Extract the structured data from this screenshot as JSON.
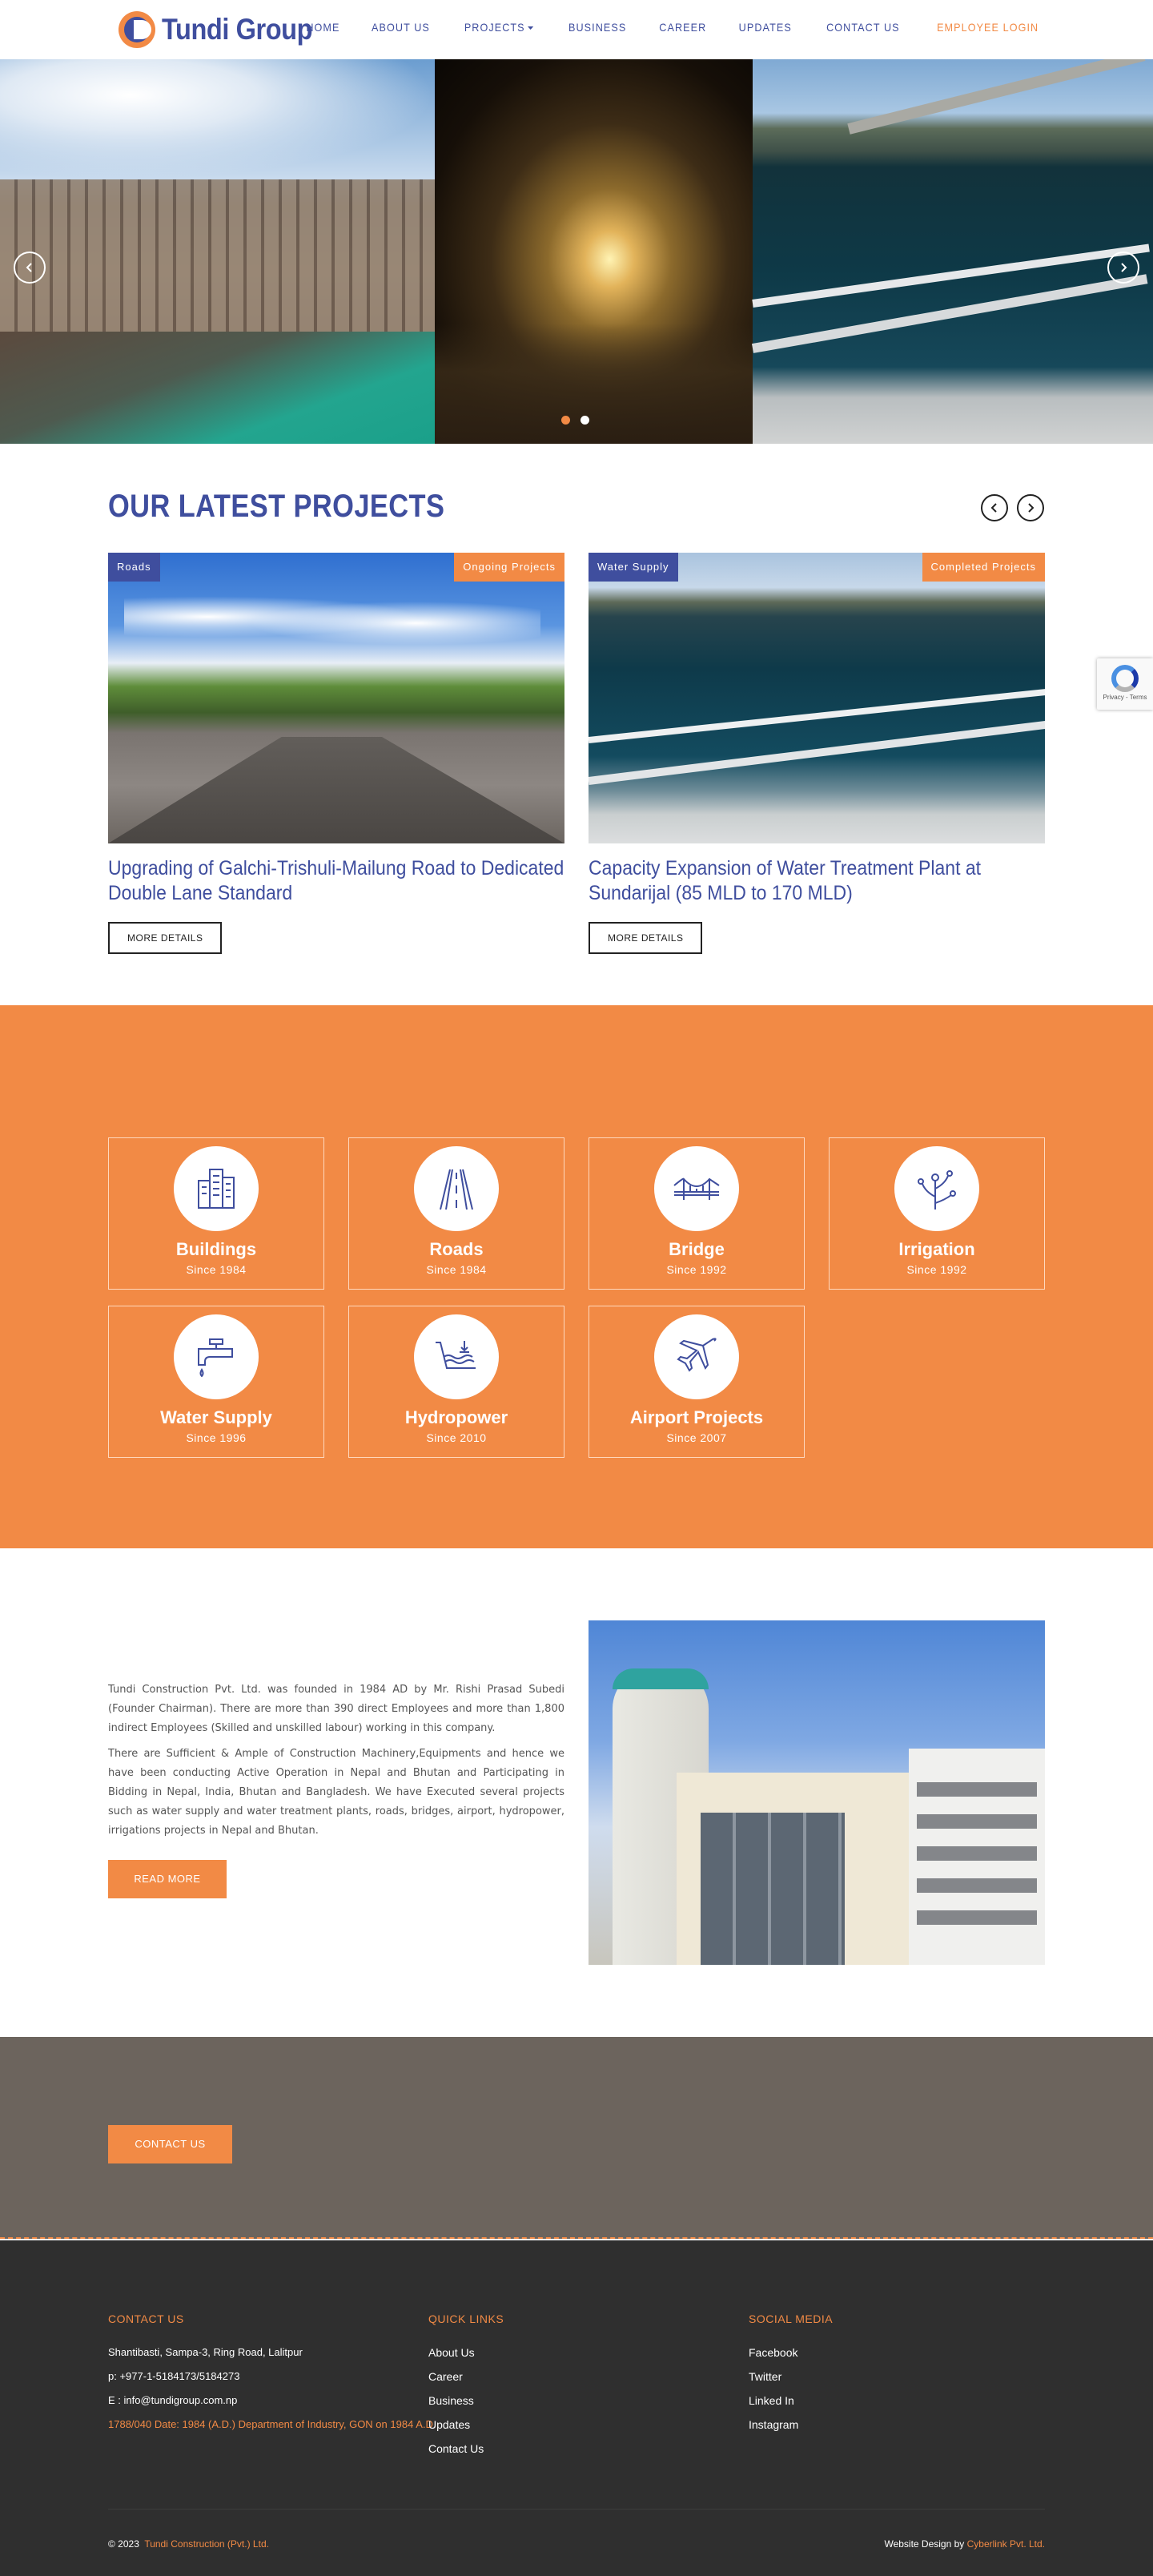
{
  "brand": {
    "name": "Tundi Group"
  },
  "nav": {
    "items": [
      {
        "label": "HOME"
      },
      {
        "label": "ABOUT US"
      },
      {
        "label": "PROJECTS",
        "dropdown": true
      },
      {
        "label": "BUSINESS"
      },
      {
        "label": "CAREER"
      },
      {
        "label": "UPDATES"
      },
      {
        "label": "CONTACT US"
      }
    ],
    "login_label": "EMPLOYEE LOGIN"
  },
  "hero": {
    "prev_icon": "chevron-left-icon",
    "next_icon": "chevron-right-icon",
    "slides_count": 2,
    "active_slide": 1
  },
  "projects": {
    "title": "OUR LATEST PROJECTS",
    "cards": [
      {
        "category": "Roads",
        "status": "Ongoing Projects",
        "title": "Upgrading of Galchi-Trishuli-Mailung Road to Dedicated Double Lane Standard",
        "button": "MORE DETAILS"
      },
      {
        "category": "Water Supply",
        "status": "Completed Projects",
        "title": "Capacity Expansion of Water Treatment Plant at Sundarijal (85 MLD to 170 MLD)",
        "button": "MORE DETAILS"
      }
    ]
  },
  "services": [
    {
      "name": "Buildings",
      "since": "Since 1984",
      "icon": "buildings-icon"
    },
    {
      "name": "Roads",
      "since": "Since 1984",
      "icon": "road-icon"
    },
    {
      "name": "Bridge",
      "since": "Since 1992",
      "icon": "bridge-icon"
    },
    {
      "name": "Irrigation",
      "since": "Since 1992",
      "icon": "irrigation-icon"
    },
    {
      "name": "Water Supply",
      "since": "Since 1996",
      "icon": "water-tap-icon"
    },
    {
      "name": "Hydropower",
      "since": "Since 2010",
      "icon": "hydropower-icon"
    },
    {
      "name": "Airport Projects",
      "since": "Since 2007",
      "icon": "airplane-icon"
    }
  ],
  "about": {
    "p1": "Tundi Construction Pvt. Ltd. was founded in 1984 AD by Mr. Rishi Prasad Subedi (Founder Chairman). There are more than 390 direct Employees and more than 1,800 indirect Employees (Skilled and unskilled labour) working in this company.",
    "p2": "There are Sufficient & Ample of Construction Machinery,Equipments and hence we have been conducting Active Operation in Nepal and Bhutan and Participating in Bidding in Nepal, India, Bhutan and Bangladesh. We have Executed several projects such as water supply and water treatment plants, roads, bridges, airport, hydropower, irrigations projects in Nepal and Bhutan.",
    "button": "READ MORE"
  },
  "cta": {
    "button": "CONTACT US"
  },
  "footer": {
    "contact": {
      "heading": "CONTACT US",
      "address": "Shantibasti, Sampa-3, Ring Road, Lalitpur",
      "phone": "p: +977-1-5184173/5184273",
      "email": "E : info@tundigroup.com.np",
      "registration": "1788/040 Date: 1984 (A.D.) Department of Industry, GON on 1984 A.D."
    },
    "quick_links": {
      "heading": "QUICK LINKS",
      "items": [
        "About Us",
        "Career",
        "Business",
        "Updates",
        "Contact Us"
      ]
    },
    "social": {
      "heading": "SOCIAL MEDIA",
      "items": [
        "Facebook",
        "Twitter",
        "Linked In",
        "Instagram"
      ]
    },
    "copyright_prefix": "© 2023",
    "copyright_org": "Tundi Construction (Pvt.) Ltd.",
    "credit_prefix": "Website Design by",
    "credit_org": "Cyberlink Pvt. Ltd."
  },
  "recaptcha": {
    "text": "Privacy - Terms"
  },
  "colors": {
    "primary": "#3f4e9e",
    "accent": "#f28a45",
    "cta_bg": "#6c645d",
    "footer_bg": "#2f2f2f"
  }
}
